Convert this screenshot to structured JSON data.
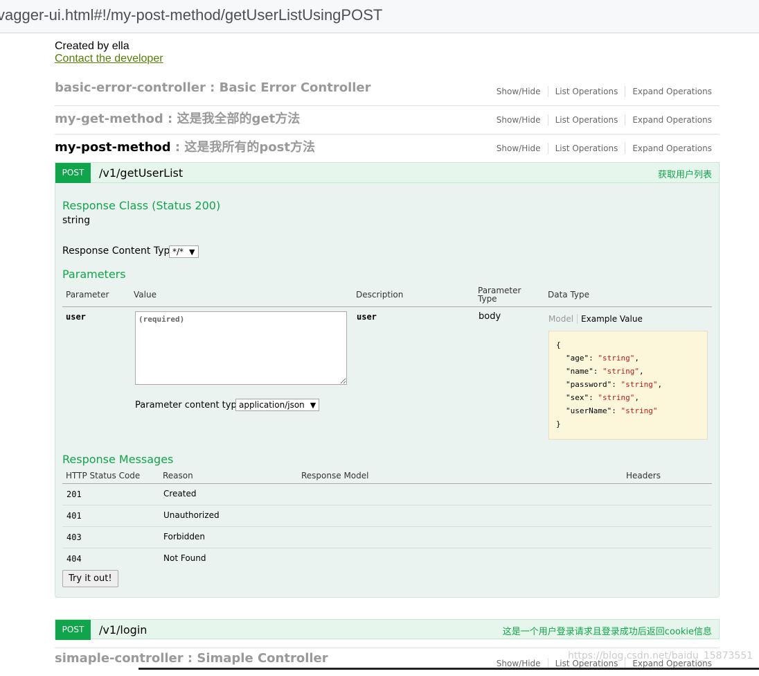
{
  "browser": {
    "url": "vagger-ui.html#!/my-post-method/getUserListUsingPOST"
  },
  "info": {
    "created_by": "Created by ella",
    "contact": "Contact the developer"
  },
  "resource_ops": {
    "show_hide": "Show/Hide",
    "list": "List Operations",
    "expand": "Expand Operations"
  },
  "resources": [
    {
      "name": "basic-error-controller",
      "sep": " : ",
      "desc": "Basic Error Controller"
    },
    {
      "name": "my-get-method",
      "sep": " : ",
      "desc": "这是我全部的get方法"
    },
    {
      "name": "my-post-method",
      "sep": " : ",
      "desc": "这是我所有的post方法"
    },
    {
      "name": "simaple-controller",
      "sep": " : ",
      "desc": "Simaple Controller"
    }
  ],
  "operation": {
    "method": "POST",
    "path": "/v1/getUserList",
    "summary": "获取用户列表",
    "response_class_heading": "Response Class (Status 200)",
    "response_class_value": "string",
    "response_content_type_label": "Response Content Type",
    "response_content_type_value": "*/*",
    "parameters_heading": "Parameters",
    "param_headers": {
      "parameter": "Parameter",
      "value": "Value",
      "description": "Description",
      "param_type": "Parameter Type",
      "data_type": "Data Type"
    },
    "param": {
      "name": "user",
      "placeholder": "(required)",
      "description": "user",
      "type": "body",
      "model_tab": "Model",
      "example_tab": "Example Value",
      "content_type_label": "Parameter content type:",
      "content_type_value": "application/json",
      "example": {
        "open": "{",
        "close": "}",
        "fields": [
          {
            "key": "\"age\"",
            "value": "\"string\"",
            "comma": ","
          },
          {
            "key": "\"name\"",
            "value": "\"string\"",
            "comma": ","
          },
          {
            "key": "\"password\"",
            "value": "\"string\"",
            "comma": ","
          },
          {
            "key": "\"sex\"",
            "value": "\"string\"",
            "comma": ","
          },
          {
            "key": "\"userName\"",
            "value": "\"string\"",
            "comma": ""
          }
        ]
      }
    },
    "response_messages_heading": "Response Messages",
    "resp_headers": {
      "code": "HTTP Status Code",
      "reason": "Reason",
      "model": "Response Model",
      "headers": "Headers"
    },
    "responses": [
      {
        "code": "201",
        "reason": "Created"
      },
      {
        "code": "401",
        "reason": "Unauthorized"
      },
      {
        "code": "403",
        "reason": "Forbidden"
      },
      {
        "code": "404",
        "reason": "Not Found"
      }
    ],
    "try_button": "Try it out!"
  },
  "operation2": {
    "method": "POST",
    "path": "/v1/login",
    "summary": "这是一个用户登录请求且登录成功后返回cookie信息"
  },
  "watermark": "https://blog.csdn.net/baidu_15873551",
  "colors": {
    "green": "#10a54a",
    "link": "#547f00",
    "example_bg": "#fcf6db"
  }
}
